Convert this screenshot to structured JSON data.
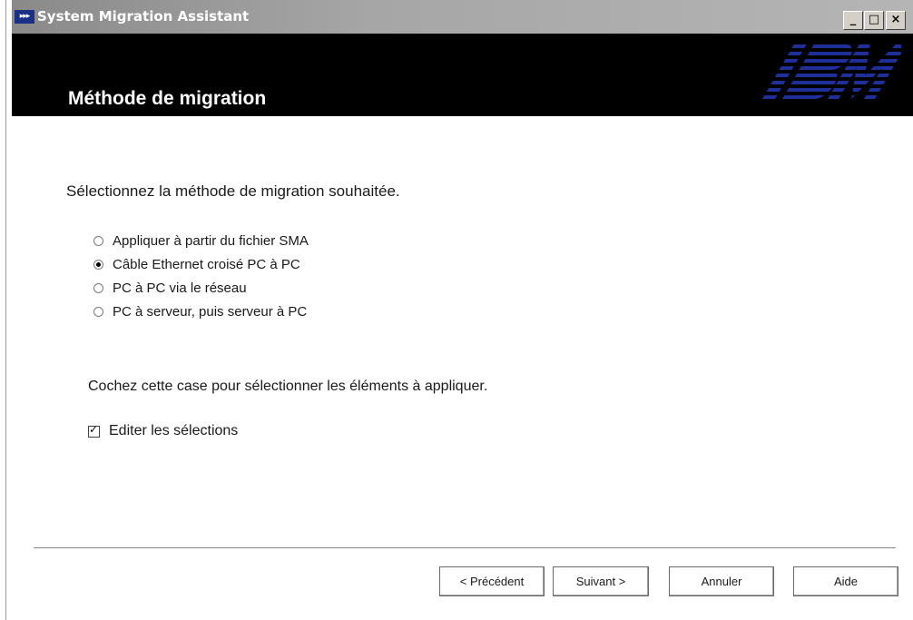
{
  "window": {
    "title": "System Migration Assistant",
    "app_icon": "▸▸▸",
    "min_glyph": "_",
    "max_glyph": "□",
    "close_glyph": "×"
  },
  "header": {
    "page_title": "Méthode de migration",
    "logo_text": "IBM"
  },
  "main": {
    "instruction": "Sélectionnez la méthode de migration souhaitée.",
    "options": [
      {
        "label": "Appliquer à partir du fichier SMA",
        "checked": false
      },
      {
        "label": "Câble Ethernet croisé PC à PC",
        "checked": true
      },
      {
        "label": "PC à PC via le réseau",
        "checked": false
      },
      {
        "label": "PC à serveur, puis serveur à PC",
        "checked": false
      }
    ],
    "hint": "Cochez cette case pour sélectionner les éléments à appliquer.",
    "checkbox": {
      "label": "Editer les sélections",
      "checked": true
    }
  },
  "buttons": {
    "prev": "< Précédent",
    "next": "Suivant >",
    "cancel": "Annuler",
    "help": "Aide"
  },
  "colors": {
    "header_bg": "#000000",
    "title_bar": "#a6a6a6",
    "logo_blue": "#1f2f9a"
  }
}
